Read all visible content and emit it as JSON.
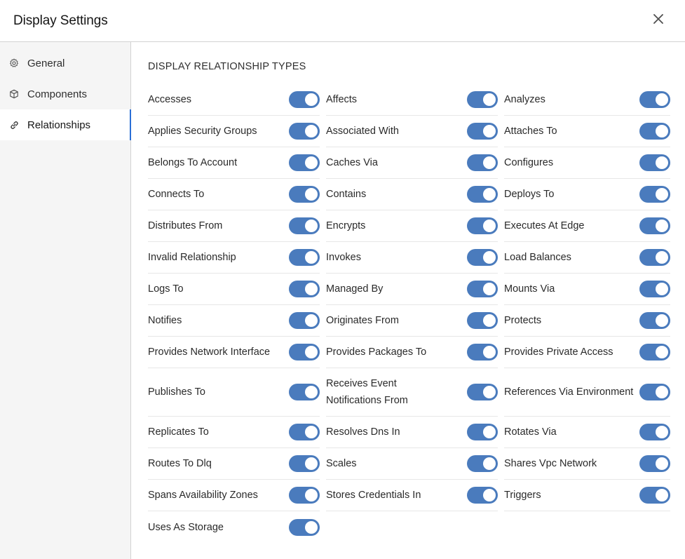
{
  "dialog": {
    "title": "Display Settings",
    "close_icon": "close-icon"
  },
  "sidebar": {
    "items": [
      {
        "label": "General",
        "icon": "gear-icon",
        "active": false
      },
      {
        "label": "Components",
        "icon": "cube-icon",
        "active": false
      },
      {
        "label": "Relationships",
        "icon": "link-icon",
        "active": true
      }
    ]
  },
  "main": {
    "section_title": "DISPLAY RELATIONSHIP TYPES",
    "toggle_color": "#4a7bbd",
    "relationships": [
      {
        "label": "Accesses",
        "enabled": true
      },
      {
        "label": "Affects",
        "enabled": true
      },
      {
        "label": "Analyzes",
        "enabled": true
      },
      {
        "label": "Applies Security Groups",
        "enabled": true
      },
      {
        "label": "Associated With",
        "enabled": true
      },
      {
        "label": "Attaches To",
        "enabled": true
      },
      {
        "label": "Belongs To Account",
        "enabled": true
      },
      {
        "label": "Caches Via",
        "enabled": true
      },
      {
        "label": "Configures",
        "enabled": true
      },
      {
        "label": "Connects To",
        "enabled": true
      },
      {
        "label": "Contains",
        "enabled": true
      },
      {
        "label": "Deploys To",
        "enabled": true
      },
      {
        "label": "Distributes From",
        "enabled": true
      },
      {
        "label": "Encrypts",
        "enabled": true
      },
      {
        "label": "Executes At Edge",
        "enabled": true
      },
      {
        "label": "Invalid Relationship",
        "enabled": true
      },
      {
        "label": "Invokes",
        "enabled": true
      },
      {
        "label": "Load Balances",
        "enabled": true
      },
      {
        "label": "Logs To",
        "enabled": true
      },
      {
        "label": "Managed By",
        "enabled": true
      },
      {
        "label": "Mounts Via",
        "enabled": true
      },
      {
        "label": "Notifies",
        "enabled": true
      },
      {
        "label": "Originates From",
        "enabled": true
      },
      {
        "label": "Protects",
        "enabled": true
      },
      {
        "label": "Provides Network Interface",
        "enabled": true
      },
      {
        "label": "Provides Packages To",
        "enabled": true
      },
      {
        "label": "Provides Private Access",
        "enabled": true
      },
      {
        "label": "Publishes To",
        "enabled": true
      },
      {
        "label": "Receives Event Notifications From",
        "enabled": true
      },
      {
        "label": "References Via Environment",
        "enabled": true
      },
      {
        "label": "Replicates To",
        "enabled": true
      },
      {
        "label": "Resolves Dns In",
        "enabled": true
      },
      {
        "label": "Rotates Via",
        "enabled": true
      },
      {
        "label": "Routes To Dlq",
        "enabled": true
      },
      {
        "label": "Scales",
        "enabled": true
      },
      {
        "label": "Shares Vpc Network",
        "enabled": true
      },
      {
        "label": "Spans Availability Zones",
        "enabled": true
      },
      {
        "label": "Stores Credentials In",
        "enabled": true
      },
      {
        "label": "Triggers",
        "enabled": true
      },
      {
        "label": "Uses As Storage",
        "enabled": true
      }
    ]
  }
}
